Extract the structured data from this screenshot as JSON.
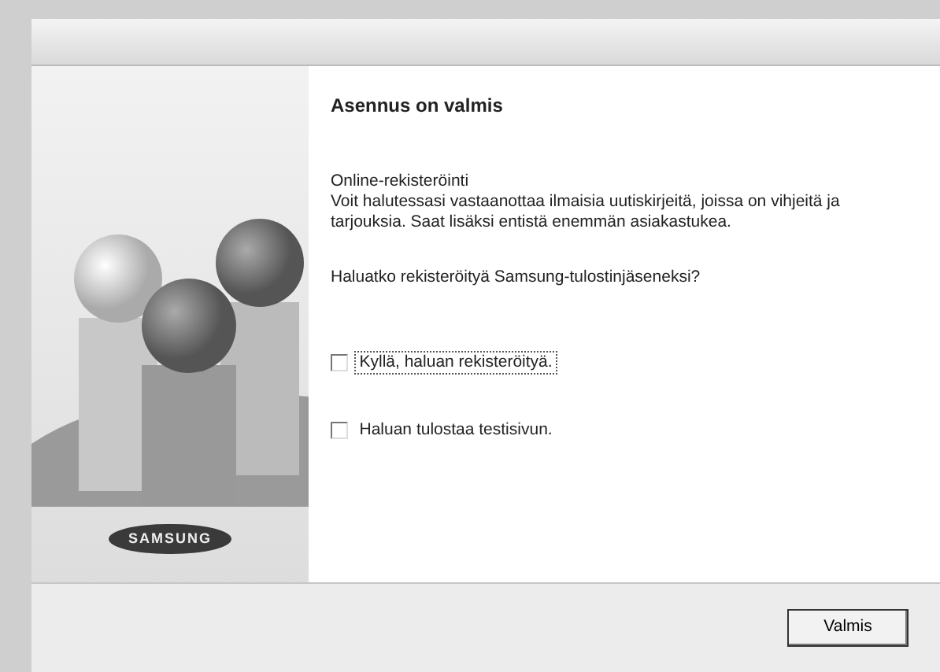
{
  "sidebar": {
    "logo": "SAMSUNG"
  },
  "heading": "Asennus on valmis",
  "section_title": "Online-rekisteröinti",
  "description": "Voit halutessasi vastaanottaa ilmaisia uutiskirjeitä, joissa on vihjeitä ja tarjouksia. Saat lisäksi entistä enemmän asiakastukea.",
  "question": "Haluatko rekisteröityä Samsung-tulostinjäseneksi?",
  "options": [
    {
      "label": "Kyllä, haluan rekisteröityä.",
      "checked": false,
      "focused": true
    },
    {
      "label": "Haluan tulostaa testisivun.",
      "checked": false,
      "focused": false
    }
  ],
  "buttons": [
    "Valmis"
  ]
}
